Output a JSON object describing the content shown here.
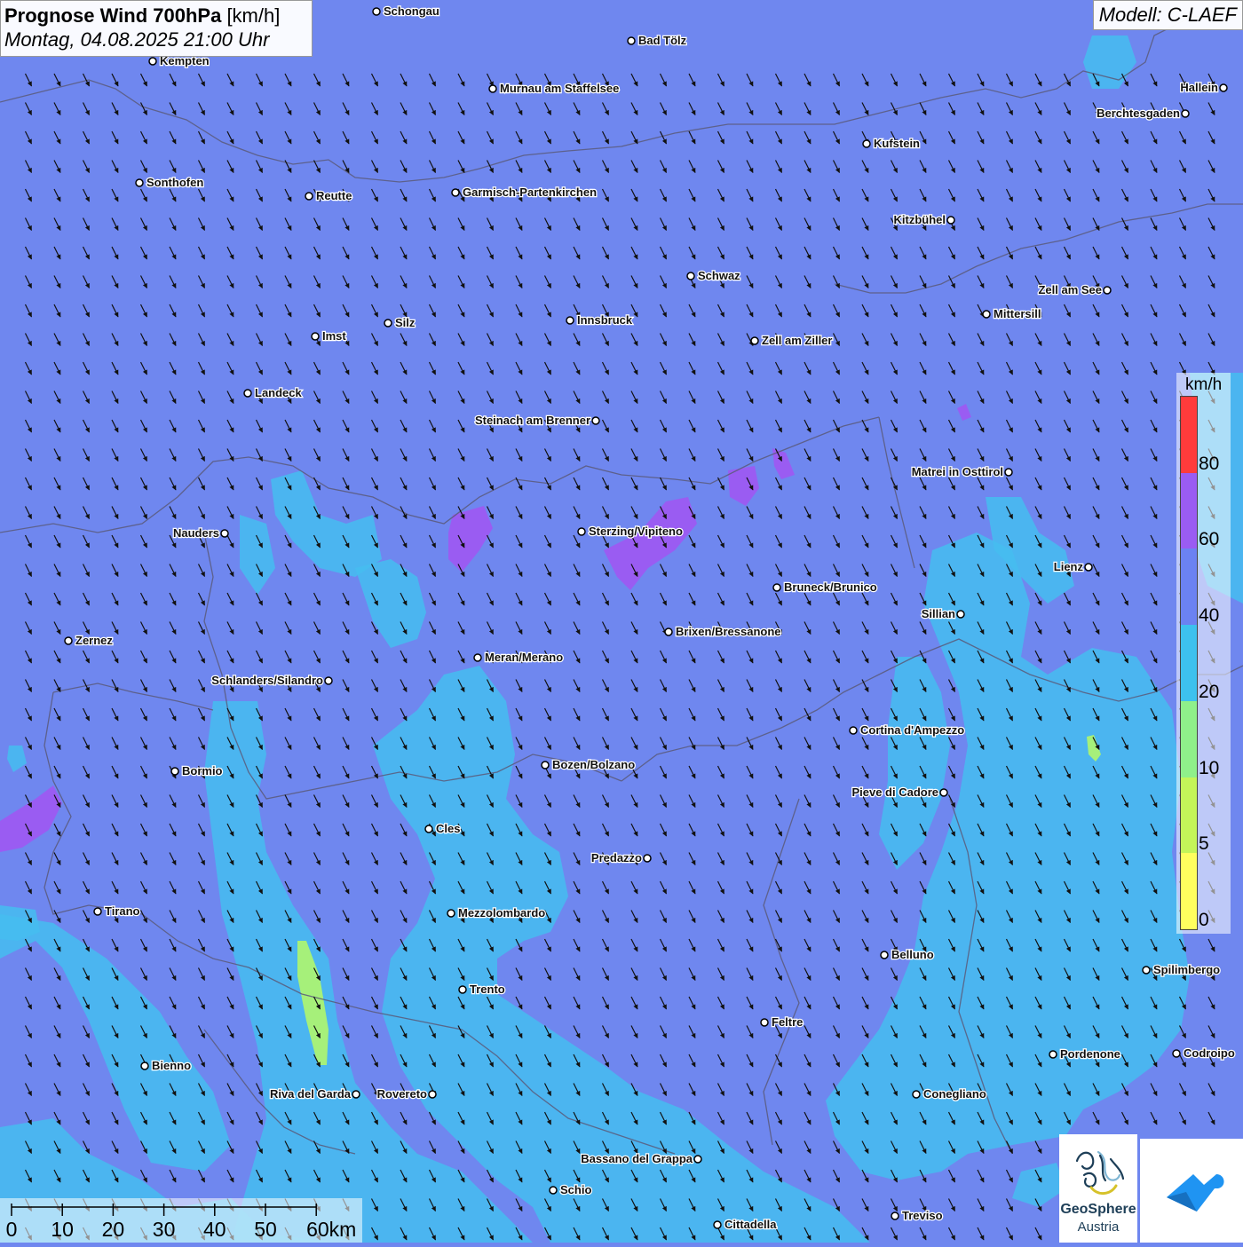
{
  "header": {
    "title": "Prognose Wind 700hPa",
    "unit": "[km/h]",
    "datetime": "Montag, 04.08.2025 21:00 Uhr",
    "model": "Modell: C-LAEF"
  },
  "legend": {
    "unit": "km/h",
    "steps": [
      {
        "value": "80",
        "color": "#ff3b3b"
      },
      {
        "value": "60",
        "color": "#9a5cf2"
      },
      {
        "value": "40",
        "color": "#6b82f2"
      },
      {
        "value": "20",
        "color": "#3dc1ee"
      },
      {
        "value": "10",
        "color": "#8ff08a"
      },
      {
        "value": "5",
        "color": "#c4f559"
      },
      {
        "value": "0",
        "color": "#ffff5e"
      }
    ]
  },
  "scale": {
    "labels": [
      "0",
      "10",
      "20",
      "30",
      "40",
      "50",
      "60km"
    ]
  },
  "logos": {
    "geosphere_line1": "GeoSphere",
    "geosphere_line2": "Austria"
  },
  "colors": {
    "background": "#6f87ef",
    "band_40_60": "#6b82f2",
    "band_20_40": "#45bdf0",
    "band_60_80": "#9a5cf2",
    "band_10_20": "#a6f07a"
  },
  "cities": [
    {
      "name": "Schongau",
      "label_side": "right"
    },
    {
      "name": "Bad Tölz",
      "label_side": "right"
    },
    {
      "name": "Kempten",
      "label_side": "right"
    },
    {
      "name": "Murnau am Staffelsee",
      "label_side": "right"
    },
    {
      "name": "Hallein",
      "label_side": "left"
    },
    {
      "name": "Berchtesgaden",
      "label_side": "left"
    },
    {
      "name": "Kufstein",
      "label_side": "right"
    },
    {
      "name": "Sonthofen",
      "label_side": "right"
    },
    {
      "name": "Reutte",
      "label_side": "right"
    },
    {
      "name": "Garmisch-Partenkirchen",
      "label_side": "right"
    },
    {
      "name": "Kitzbühel",
      "label_side": "left"
    },
    {
      "name": "Schwaz",
      "label_side": "right"
    },
    {
      "name": "Zell am See",
      "label_side": "left"
    },
    {
      "name": "Innsbruck",
      "label_side": "right"
    },
    {
      "name": "Silz",
      "label_side": "right"
    },
    {
      "name": "Mittersill",
      "label_side": "right"
    },
    {
      "name": "Imst",
      "label_side": "right"
    },
    {
      "name": "Zell am Ziller",
      "label_side": "right"
    },
    {
      "name": "Landeck",
      "label_side": "right"
    },
    {
      "name": "Steinach am Brenner",
      "label_side": "left"
    },
    {
      "name": "Matrei in Osttirol",
      "label_side": "left"
    },
    {
      "name": "Nauders",
      "label_side": "left"
    },
    {
      "name": "Sterzing/Vipiteno",
      "label_side": "right"
    },
    {
      "name": "Lienz",
      "label_side": "left"
    },
    {
      "name": "Bruneck/Brunico",
      "label_side": "right"
    },
    {
      "name": "Sillian",
      "label_side": "left"
    },
    {
      "name": "Zernez",
      "label_side": "right"
    },
    {
      "name": "Brixen/Bressanone",
      "label_side": "right"
    },
    {
      "name": "Meran/Merano",
      "label_side": "right"
    },
    {
      "name": "Schlanders/Silandro",
      "label_side": "left"
    },
    {
      "name": "Cortina d'Ampezzo",
      "label_side": "right"
    },
    {
      "name": "Bozen/Bolzano",
      "label_side": "right"
    },
    {
      "name": "Bormio",
      "label_side": "right"
    },
    {
      "name": "Pieve di Cadore",
      "label_side": "left"
    },
    {
      "name": "Cles",
      "label_side": "right"
    },
    {
      "name": "Predazzo",
      "label_side": "left"
    },
    {
      "name": "Tirano",
      "label_side": "right"
    },
    {
      "name": "Mezzolombardo",
      "label_side": "right"
    },
    {
      "name": "Belluno",
      "label_side": "right"
    },
    {
      "name": "Spilimbergo",
      "label_side": "right"
    },
    {
      "name": "Trento",
      "label_side": "right"
    },
    {
      "name": "Feltre",
      "label_side": "right"
    },
    {
      "name": "Pordenone",
      "label_side": "right"
    },
    {
      "name": "Codroipo",
      "label_side": "right"
    },
    {
      "name": "Bienno",
      "label_side": "right"
    },
    {
      "name": "Riva del Garda",
      "label_side": "left"
    },
    {
      "name": "Rovereto",
      "label_side": "left"
    },
    {
      "name": "Conegliano",
      "label_side": "right"
    },
    {
      "name": "Bassano del Grappa",
      "label_side": "left"
    },
    {
      "name": "Schio",
      "label_side": "right"
    },
    {
      "name": "Treviso",
      "label_side": "right"
    },
    {
      "name": "Cittadella",
      "label_side": "right"
    }
  ]
}
